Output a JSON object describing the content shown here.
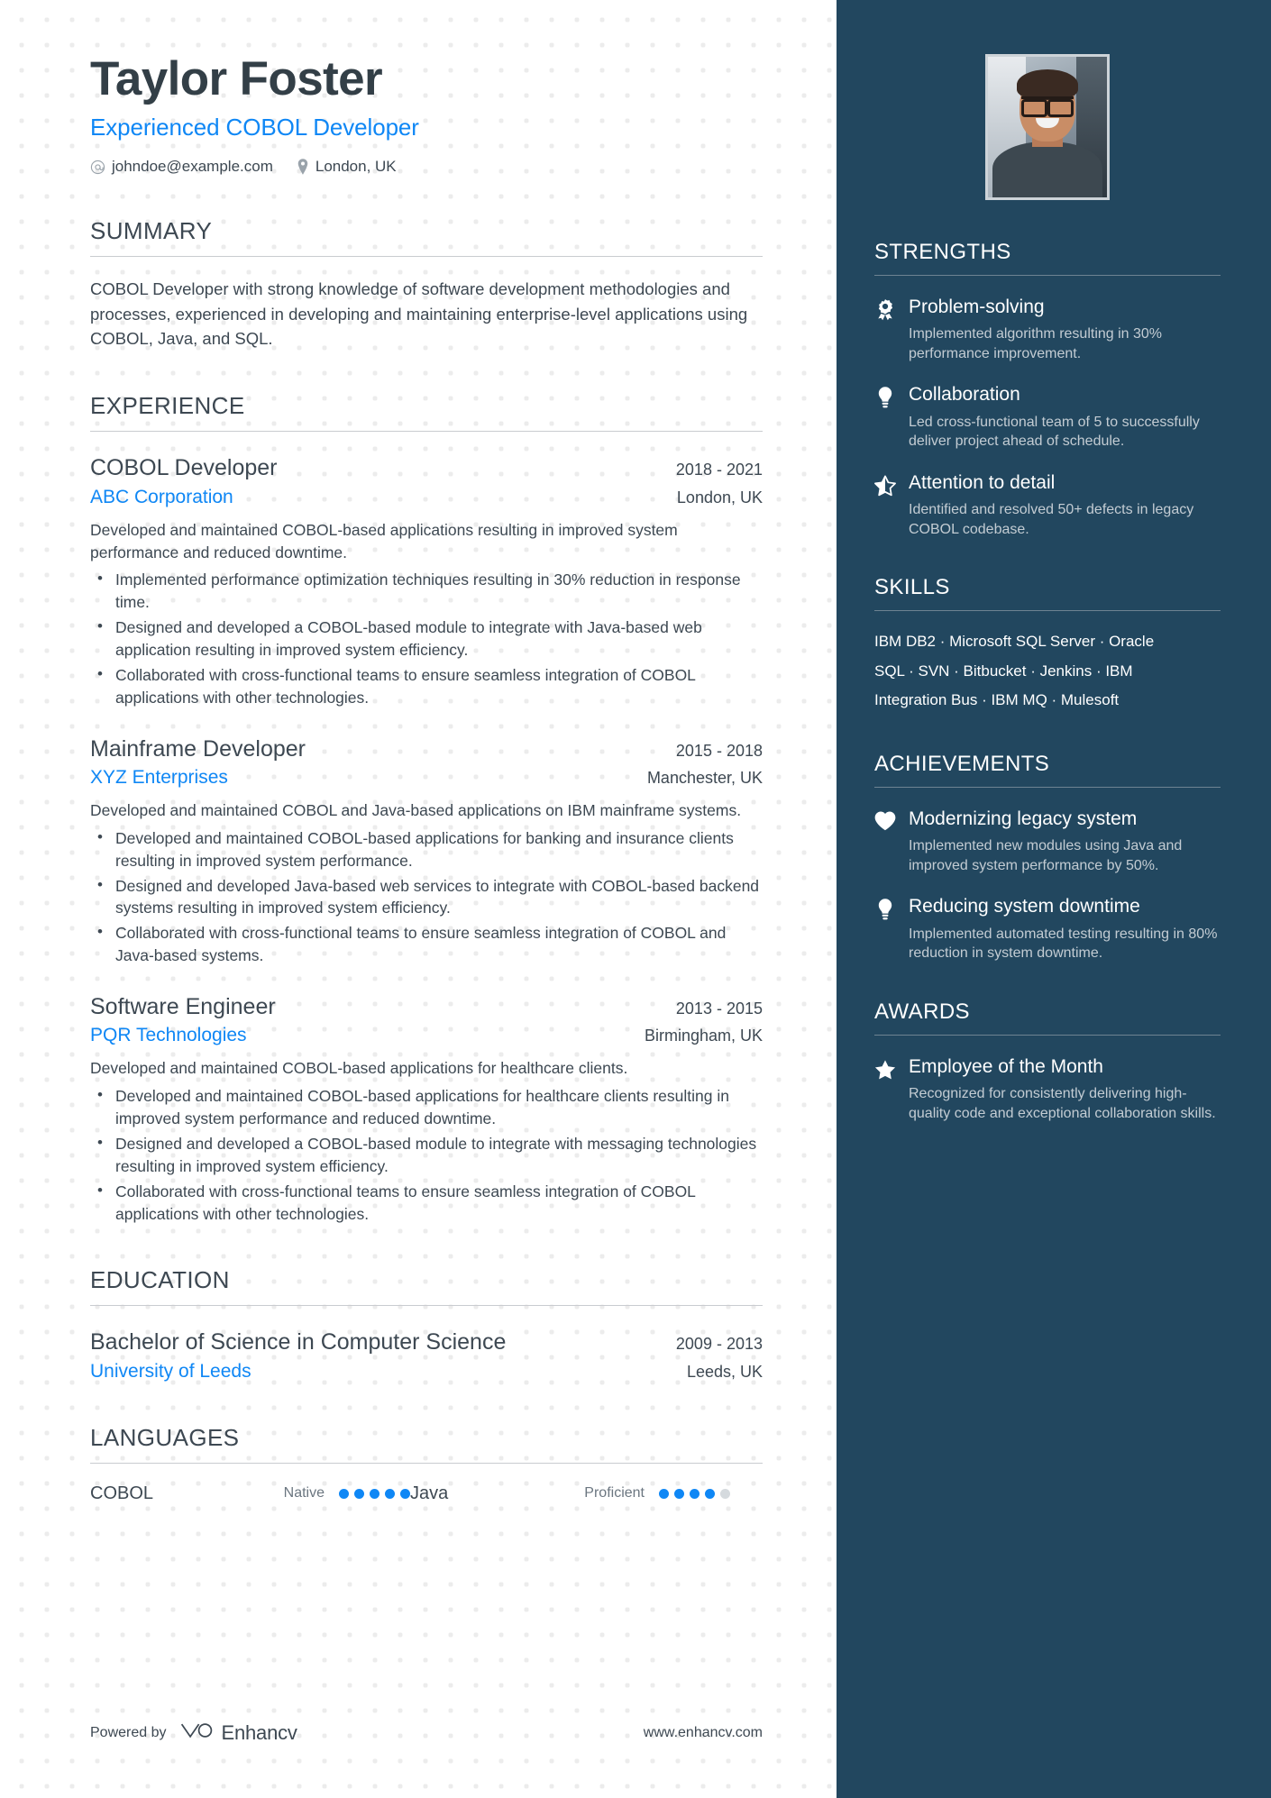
{
  "theme": {
    "accent_blue": "#0f87f5",
    "sidebar_bg": "#22475f",
    "text_dark": "#3d4852"
  },
  "header": {
    "name": "Taylor Foster",
    "headline": "Experienced COBOL Developer",
    "email": "johndoe@example.com",
    "location": "London, UK",
    "email_icon": "at-icon",
    "location_icon": "map-pin-icon"
  },
  "summary": {
    "title": "SUMMARY",
    "text": "COBOL Developer with strong knowledge of software development methodologies and processes, experienced in developing and maintaining enterprise-level applications using COBOL, Java, and SQL."
  },
  "experience": {
    "title": "EXPERIENCE",
    "jobs": [
      {
        "title": "COBOL Developer",
        "dates": "2018 - 2021",
        "company": "ABC Corporation",
        "location": "London, UK",
        "description": "Developed and maintained COBOL-based applications resulting in improved system performance and reduced downtime.",
        "bullets": [
          "Implemented performance optimization techniques resulting in 30% reduction in response time.",
          "Designed and developed a COBOL-based module to integrate with Java-based web application resulting in improved system efficiency.",
          "Collaborated with cross-functional teams to ensure seamless integration of COBOL applications with other technologies."
        ]
      },
      {
        "title": "Mainframe Developer",
        "dates": "2015 - 2018",
        "company": "XYZ Enterprises",
        "location": "Manchester, UK",
        "description": "Developed and maintained COBOL and Java-based applications on IBM mainframe systems.",
        "bullets": [
          "Developed and maintained COBOL-based applications for banking and insurance clients resulting in improved system performance.",
          "Designed and developed Java-based web services to integrate with COBOL-based backend systems resulting in improved system efficiency.",
          "Collaborated with cross-functional teams to ensure seamless integration of COBOL and Java-based systems."
        ]
      },
      {
        "title": "Software Engineer",
        "dates": "2013 - 2015",
        "company": "PQR Technologies",
        "location": "Birmingham, UK",
        "description": "Developed and maintained COBOL-based applications for healthcare clients.",
        "bullets": [
          "Developed and maintained COBOL-based applications for healthcare clients resulting in improved system performance and reduced downtime.",
          "Designed and developed a COBOL-based module to integrate with messaging technologies resulting in improved system efficiency.",
          "Collaborated with cross-functional teams to ensure seamless integration of COBOL applications with other technologies."
        ]
      }
    ]
  },
  "education": {
    "title": "EDUCATION",
    "entries": [
      {
        "degree": "Bachelor of Science in Computer Science",
        "dates": "2009 - 2013",
        "school": "University of Leeds",
        "location": "Leeds, UK"
      }
    ]
  },
  "languages": {
    "title": "LANGUAGES",
    "items": [
      {
        "name": "COBOL",
        "level": "Native",
        "filled": 5,
        "total": 5
      },
      {
        "name": "Java",
        "level": "Proficient",
        "filled": 4,
        "total": 5
      }
    ]
  },
  "footer": {
    "powered_by": "Powered by",
    "brand": "Enhancv",
    "brand_icon": "enhancv-logo-icon",
    "website": "www.enhancv.com"
  },
  "sidebar": {
    "photo_alt": "portrait-photo",
    "strengths": {
      "title": "STRENGTHS",
      "items": [
        {
          "icon": "award-ribbon-icon",
          "title": "Problem-solving",
          "desc": "Implemented algorithm resulting in 30% performance improvement."
        },
        {
          "icon": "lightbulb-icon",
          "title": "Collaboration",
          "desc": "Led cross-functional team of 5 to successfully deliver project ahead of schedule."
        },
        {
          "icon": "half-star-icon",
          "title": "Attention to detail",
          "desc": "Identified and resolved 50+ defects in legacy COBOL codebase."
        }
      ]
    },
    "skills": {
      "title": "SKILLS",
      "text": "IBM DB2 · Microsoft SQL Server · Oracle SQL · SVN · Bitbucket · Jenkins · IBM Integration Bus · IBM MQ · Mulesoft"
    },
    "achievements": {
      "title": "ACHIEVEMENTS",
      "items": [
        {
          "icon": "heart-icon",
          "title": "Modernizing legacy system",
          "desc": "Implemented new modules using Java and improved system performance by 50%."
        },
        {
          "icon": "lightbulb-icon",
          "title": "Reducing system downtime",
          "desc": "Implemented automated testing resulting in 80% reduction in system downtime."
        }
      ]
    },
    "awards": {
      "title": "AWARDS",
      "items": [
        {
          "icon": "star-icon",
          "title": "Employee of the Month",
          "desc": "Recognized for consistently delivering high-quality code and exceptional collaboration skills."
        }
      ]
    }
  }
}
